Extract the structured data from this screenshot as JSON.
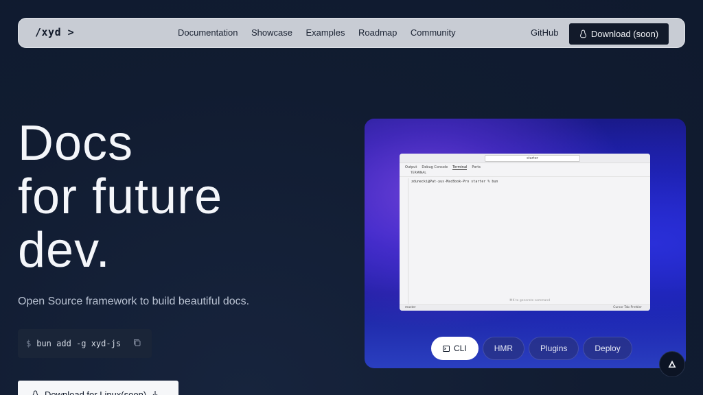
{
  "nav": {
    "logo": "/xyd >",
    "links": [
      "Documentation",
      "Showcase",
      "Examples",
      "Roadmap",
      "Community"
    ],
    "github": "GitHub",
    "download": "Download (soon)"
  },
  "hero": {
    "title_lines": [
      "Docs",
      "for future",
      "dev."
    ],
    "subtitle": "Open Source framework to build beautiful docs.",
    "command_prompt": "$",
    "command": "bun add -g xyd-js",
    "download_linux": "Download for Linux(soon)"
  },
  "preview": {
    "window_search": "starter",
    "panel_tabs": [
      "Output",
      "Debug Console",
      "Terminal",
      "Ports"
    ],
    "panel_header": "TERMINAL",
    "terminal_line": "zdunecki@Pat-yus-MacBook-Pro starter % bun",
    "status_left": "master",
    "hint": "⌘K to generate command",
    "status_right": "Cursor Tab   Prettier",
    "pills": [
      "CLI",
      "HMR",
      "Plugins",
      "Deploy"
    ]
  },
  "colors": {
    "background": "#111c31",
    "nav_bg": "#c8ccd4",
    "button_dark": "#121a2a",
    "accent_gradient_start": "#6a3fd6",
    "accent_gradient_end": "#2424c4"
  }
}
